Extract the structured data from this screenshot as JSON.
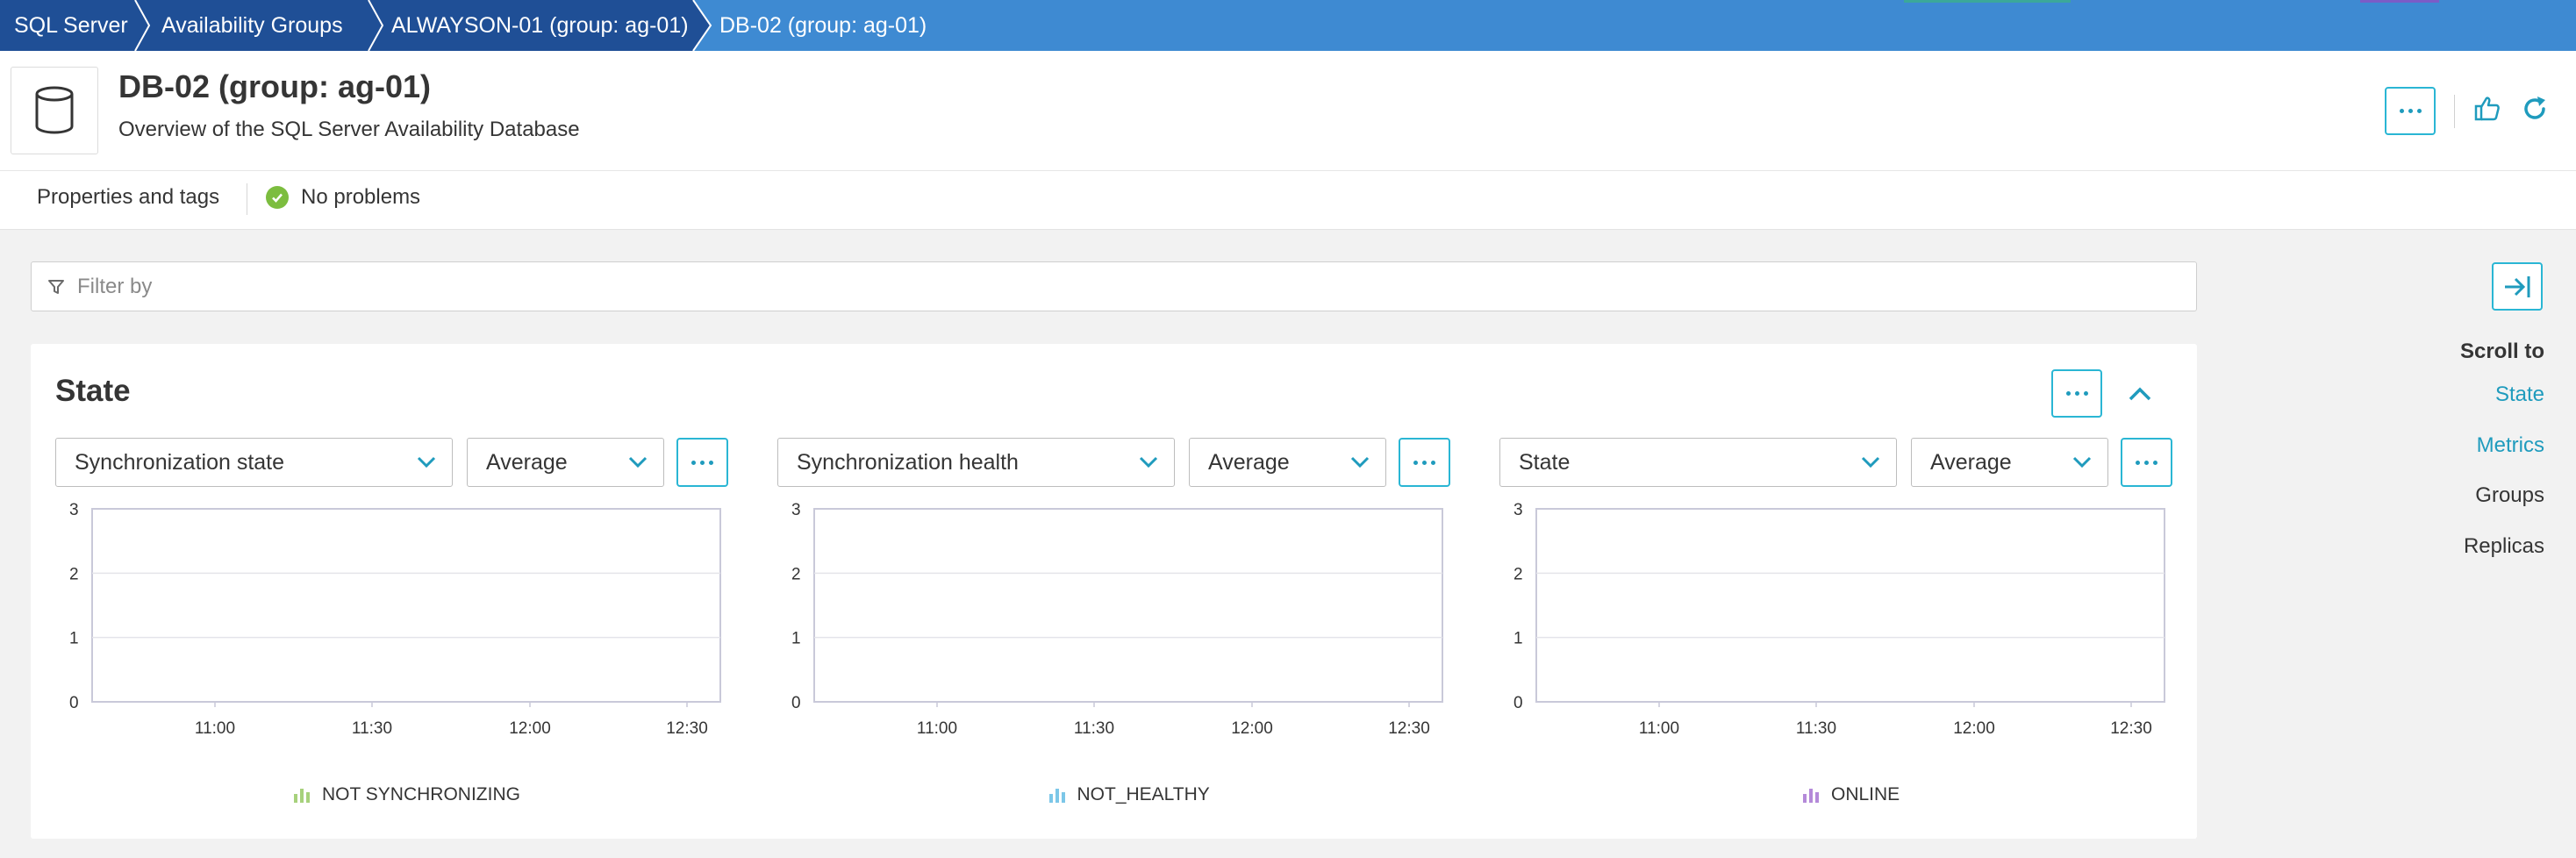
{
  "breadcrumb": {
    "items": [
      {
        "label": "SQL Server"
      },
      {
        "label": "Availability Groups"
      },
      {
        "label": "ALWAYSON-01 (group: ag-01)"
      },
      {
        "label": "DB-02 (group: ag-01)"
      }
    ]
  },
  "header": {
    "title": "DB-02 (group: ag-01)",
    "subtitle": "Overview of the SQL Server Availability Database",
    "icon": "database-icon",
    "actions": [
      "more-icon",
      "thumbs-up-icon",
      "refresh-icon"
    ]
  },
  "properties": {
    "link_label": "Properties and tags",
    "status_label": "No problems",
    "status_color": "#7cbd3f"
  },
  "filter": {
    "placeholder": "Filter by"
  },
  "scroll_nav": {
    "title": "Scroll to",
    "items": [
      {
        "label": "State",
        "active": true
      },
      {
        "label": "Metrics",
        "active": true
      },
      {
        "label": "Groups",
        "active": false
      },
      {
        "label": "Replicas",
        "active": false
      }
    ]
  },
  "state_card": {
    "title": "State",
    "charts": [
      {
        "metric_select": "Synchronization state",
        "aggregation_select": "Average",
        "y_ticks": [
          "3",
          "2",
          "1",
          "0"
        ],
        "x_ticks": [
          "11:00",
          "11:30",
          "12:00",
          "12:30"
        ],
        "legend": {
          "label": "NOT SYNCHRONIZING",
          "color": "#a7d17c"
        }
      },
      {
        "metric_select": "Synchronization health",
        "aggregation_select": "Average",
        "y_ticks": [
          "3",
          "2",
          "1",
          "0"
        ],
        "x_ticks": [
          "11:00",
          "11:30",
          "12:00",
          "12:30"
        ],
        "legend": {
          "label": "NOT_HEALTHY",
          "color": "#7cc7e8"
        }
      },
      {
        "metric_select": "State",
        "aggregation_select": "Average",
        "y_ticks": [
          "3",
          "2",
          "1",
          "0"
        ],
        "x_ticks": [
          "11:00",
          "11:30",
          "12:00",
          "12:30"
        ],
        "legend": {
          "label": "ONLINE",
          "color": "#b48ad9"
        }
      }
    ]
  },
  "colors": {
    "breadcrumb_bg": "#3e8ad2",
    "breadcrumb_dark": "#1f4f96",
    "accent": "#2ab6d4",
    "link": "#1f9bbd"
  }
}
